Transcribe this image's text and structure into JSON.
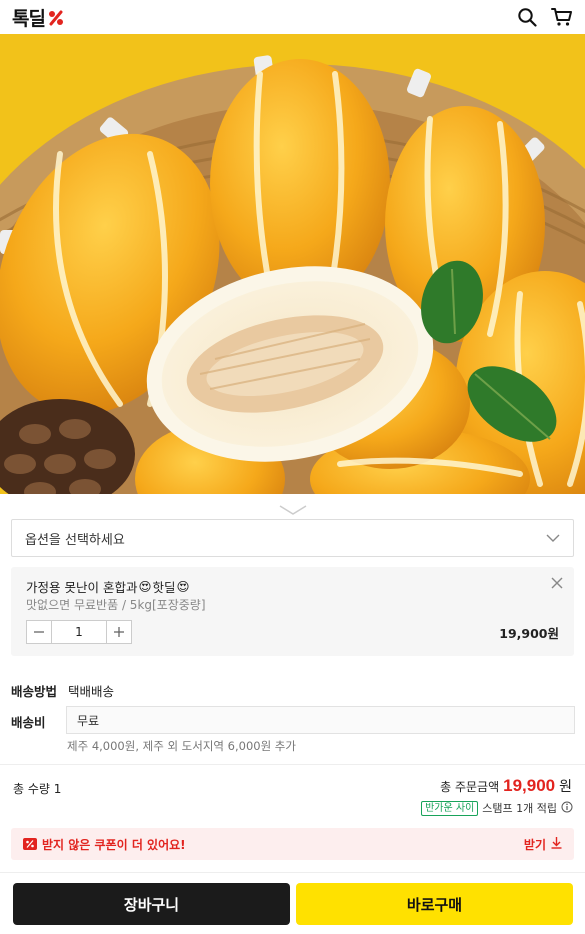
{
  "header": {
    "logo_text": "톡딜",
    "icons": [
      "search-icon",
      "cart-icon"
    ],
    "brand_color": "#e2241f"
  },
  "product_image": {
    "alt": "참외"
  },
  "option_select": {
    "placeholder": "옵션을 선택하세요"
  },
  "selected_option": {
    "name_prefix": "가정용 못난이 혼합과",
    "name_middle": "핫딜",
    "emoji": "😍",
    "desc": "맛없으면 무료반품 / 5kg[포장중량]",
    "quantity": "1",
    "price": "19,900원"
  },
  "shipping": {
    "method_label": "배송방법",
    "method_value": "택배배송",
    "fee_label": "배송비",
    "fee_value": "무료",
    "fee_note": "제주 4,000원, 제주 외 도서지역 6,000원 추가"
  },
  "totals": {
    "qty_text": "총 수량 1",
    "total_label": "총 주문금액",
    "total_amount": "19,900",
    "total_unit": "원",
    "reward_tag": "반가운 사이",
    "reward_text": "스탬프 1개 적립"
  },
  "coupon": {
    "text": "받지 않은 쿠폰이 더 있어요!",
    "action": "받기"
  },
  "actions": {
    "cart": "장바구니",
    "buy": "바로구매"
  },
  "colors": {
    "accent_red": "#e2241f",
    "buy_yellow": "#ffe100",
    "cart_black": "#1b1b1b",
    "reward_green": "#18a35a"
  }
}
